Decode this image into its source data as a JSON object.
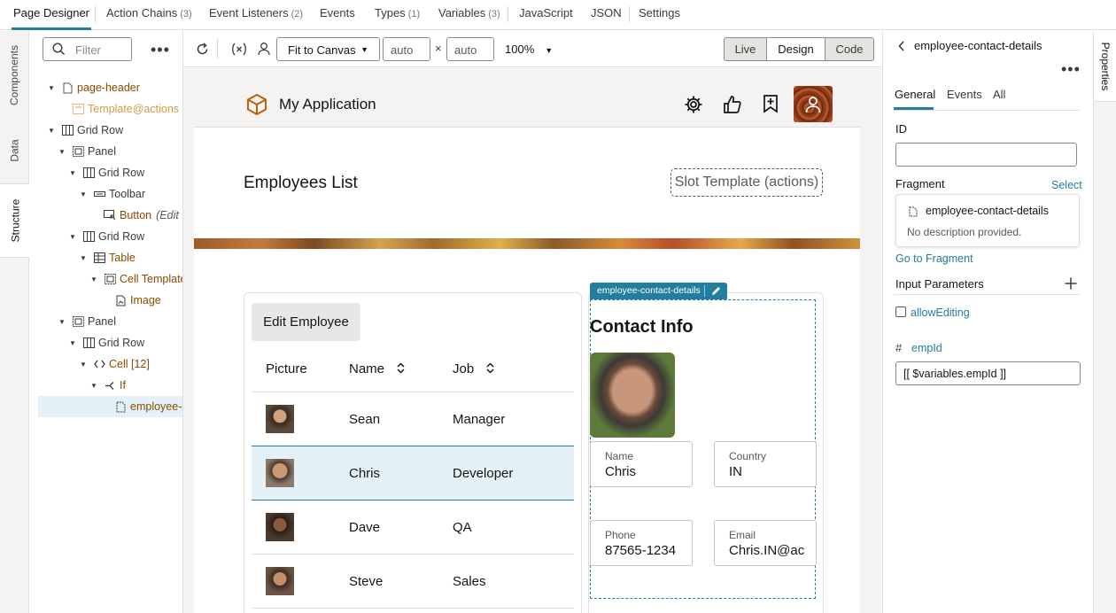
{
  "top_tabs": [
    {
      "label": "Page Designer",
      "count": ""
    },
    {
      "label": "Action Chains",
      "count": "(3)"
    },
    {
      "label": "Event Listeners",
      "count": "(2)"
    },
    {
      "label": "Events",
      "count": ""
    },
    {
      "label": "Types",
      "count": "(1)"
    },
    {
      "label": "Variables",
      "count": "(3)"
    },
    {
      "label": "JavaScript",
      "count": ""
    },
    {
      "label": "JSON",
      "count": ""
    },
    {
      "label": "Settings",
      "count": ""
    }
  ],
  "left_vtabs": {
    "components": "Components",
    "data": "Data",
    "structure": "Structure"
  },
  "structure": {
    "filter_placeholder": "Filter",
    "tree": [
      {
        "label": "page-header",
        "extra": ""
      },
      {
        "label": "Template",
        "extra": "@actions"
      },
      {
        "label": "Grid Row",
        "extra": ""
      },
      {
        "label": "Panel",
        "extra": ""
      },
      {
        "label": "Grid Row",
        "extra": ""
      },
      {
        "label": "Toolbar",
        "extra": ""
      },
      {
        "label": "Button",
        "extra": "(Edit E"
      },
      {
        "label": "Grid Row",
        "extra": ""
      },
      {
        "label": "Table",
        "extra": ""
      },
      {
        "label": "Cell Template",
        "extra": ""
      },
      {
        "label": "Image",
        "extra": ""
      },
      {
        "label": "Panel",
        "extra": ""
      },
      {
        "label": "Grid Row",
        "extra": ""
      },
      {
        "label": "Cell [12]",
        "extra": ""
      },
      {
        "label": "If",
        "extra": ""
      },
      {
        "label": "employee-c",
        "extra": ""
      }
    ]
  },
  "canvas_toolbar": {
    "fit": "Fit to Canvas",
    "width": "auto",
    "times": "×",
    "height": "auto",
    "zoom": "100%",
    "modes": {
      "live": "Live",
      "design": "Design",
      "code": "Code"
    }
  },
  "app": {
    "title": "My Application",
    "page_title": "Employees List",
    "slot_template": "Slot Template (actions)",
    "edit_button": "Edit Employee",
    "table": {
      "headers": {
        "picture": "Picture",
        "name": "Name",
        "job": "Job"
      },
      "rows": [
        {
          "name": "Sean",
          "job": "Manager"
        },
        {
          "name": "Chris",
          "job": "Developer"
        },
        {
          "name": "Dave",
          "job": "QA"
        },
        {
          "name": "Steve",
          "job": "Sales"
        }
      ]
    },
    "fragment_tag": "employee-contact-details",
    "contact": {
      "title": "Contact Info",
      "name_label": "Name",
      "name_value": "Chris",
      "country_label": "Country",
      "country_value": "IN",
      "phone_label": "Phone",
      "phone_value": "87565-1234",
      "email_label": "Email",
      "email_value": "Chris.IN@ac"
    }
  },
  "properties": {
    "vtab": "Properties",
    "back_title": "employee-contact-details",
    "tabs": {
      "general": "General",
      "events": "Events",
      "all": "All"
    },
    "id_label": "ID",
    "id_value": "",
    "fragment_label": "Fragment",
    "select_link": "Select",
    "fragment_name": "employee-contact-details",
    "fragment_desc": "No description provided.",
    "goto_link": "Go to Fragment",
    "input_params_label": "Input Parameters",
    "allow_editing": "allowEditing",
    "empid_label": "empId",
    "empid_value": "[[ $variables.empId ]]"
  },
  "colors": {
    "accent": "#227e9e",
    "selected_row": "#e4f1f7",
    "tag_bg": "#227e9e"
  }
}
